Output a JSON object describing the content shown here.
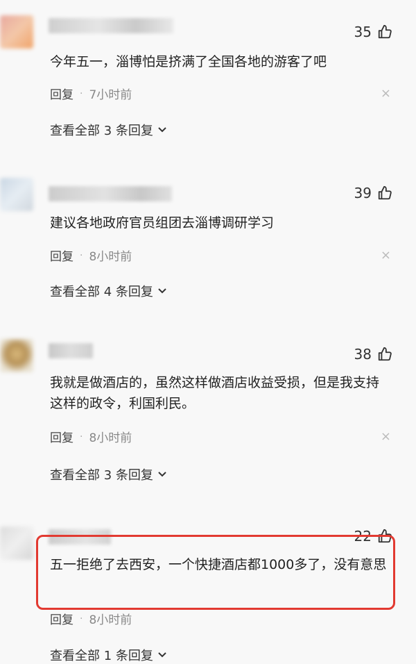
{
  "comments": [
    {
      "likes": "35",
      "text": "今年五一，淄博怕是挤满了全国各地的游客了吧",
      "reply_label": "回复",
      "time": "7小时前",
      "replies_label": "查看全部 3 条回复"
    },
    {
      "likes": "39",
      "text": "建议各地政府官员组团去淄博调研学习",
      "reply_label": "回复",
      "time": "8小时前",
      "replies_label": "查看全部 4 条回复"
    },
    {
      "likes": "38",
      "text": "我就是做酒店的，虽然这样做酒店收益受损，但是我支持这样的政令，利国利民。",
      "reply_label": "回复",
      "time": "8小时前",
      "replies_label": "查看全部 3 条回复"
    },
    {
      "likes": "22",
      "text": "五一拒绝了去西安，一个快捷酒店都1000多了，没有意思",
      "reply_label": "回复",
      "time": "8小时前",
      "replies_label": "查看全部 1 条回复"
    }
  ],
  "icons": {
    "like": "thumbs-up-icon",
    "close": "close-icon",
    "expand": "chevron-down-icon"
  },
  "colors": {
    "highlight_border": "#e23a31",
    "background": "#f8f8f8"
  }
}
